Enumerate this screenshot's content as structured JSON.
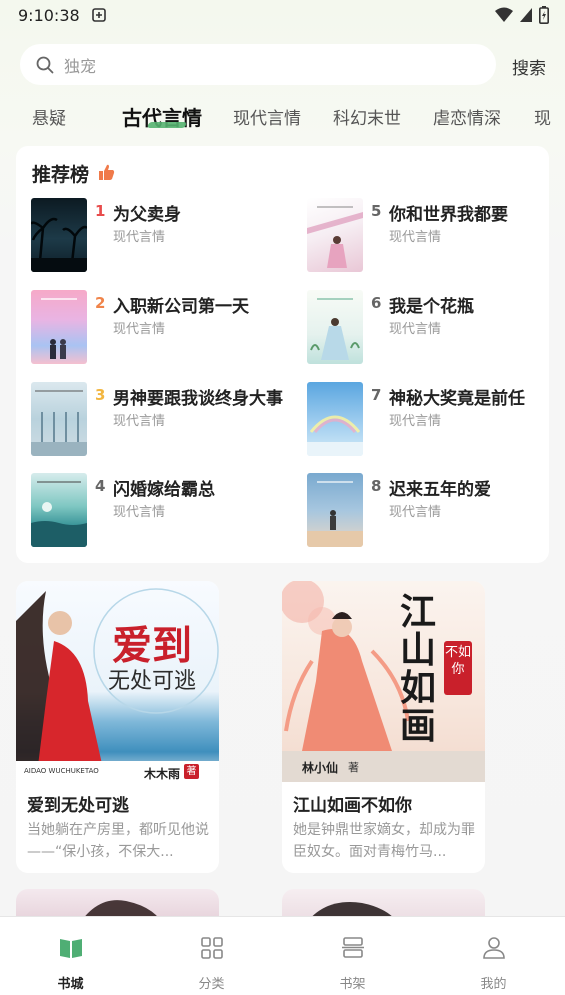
{
  "status_bar": {
    "time": "9:10:38"
  },
  "search": {
    "placeholder": "独宠",
    "button": "搜索"
  },
  "tabs": [
    {
      "label": "悬疑",
      "active": false
    },
    {
      "label": "古代言情",
      "active": true
    },
    {
      "label": "现代言情",
      "active": false
    },
    {
      "label": "科幻末世",
      "active": false
    },
    {
      "label": "虐恋情深",
      "active": false
    },
    {
      "label": "现",
      "active": false
    }
  ],
  "ranking": {
    "title": "推荐榜",
    "items": [
      {
        "rank": "1",
        "name": "为父卖身",
        "genre": "现代言情"
      },
      {
        "rank": "2",
        "name": "入职新公司第一天",
        "genre": "现代言情"
      },
      {
        "rank": "3",
        "name": "男神要跟我谈终身大事",
        "genre": "现代言情"
      },
      {
        "rank": "4",
        "name": "闪婚嫁给霸总",
        "genre": "现代言情"
      },
      {
        "rank": "5",
        "name": "你和世界我都要",
        "genre": "现代言情"
      },
      {
        "rank": "6",
        "name": "我是个花瓶",
        "genre": "现代言情"
      },
      {
        "rank": "7",
        "name": "神秘大奖竟是前任",
        "genre": "现代言情"
      },
      {
        "rank": "8",
        "name": "迟来五年的爱",
        "genre": "现代言情"
      }
    ],
    "rank_colors": {
      "1": "#e84c4c",
      "2": "#f0844a",
      "3": "#f2b640",
      "other": "#666666"
    }
  },
  "featured": [
    {
      "title": "爱到无处可逃",
      "desc": "当她躺在产房里，都听见他说——“保小孩，不保大...",
      "cover": {
        "title_line1": "爱到",
        "title_line2": "无处可逃",
        "pinyin": "AIDAO WUCHUKETAO",
        "author": "木木雨",
        "author_badge": "著"
      }
    },
    {
      "title": "江山如画不如你",
      "desc": "她是钟鼎世家嫡女，却成为罪臣奴女。面对青梅竹马...",
      "cover": {
        "title_vertical": "江山如画",
        "seal": "不如你",
        "author": "林小仙",
        "author_badge": "著"
      }
    }
  ],
  "bottom_nav": [
    {
      "label": "书城",
      "icon": "book-icon",
      "active": true
    },
    {
      "label": "分类",
      "icon": "grid-icon",
      "active": false
    },
    {
      "label": "书架",
      "icon": "shelf-icon",
      "active": false
    },
    {
      "label": "我的",
      "icon": "user-icon",
      "active": false
    }
  ],
  "colors": {
    "accent": "#55b270",
    "background": "#f5f5f5"
  }
}
